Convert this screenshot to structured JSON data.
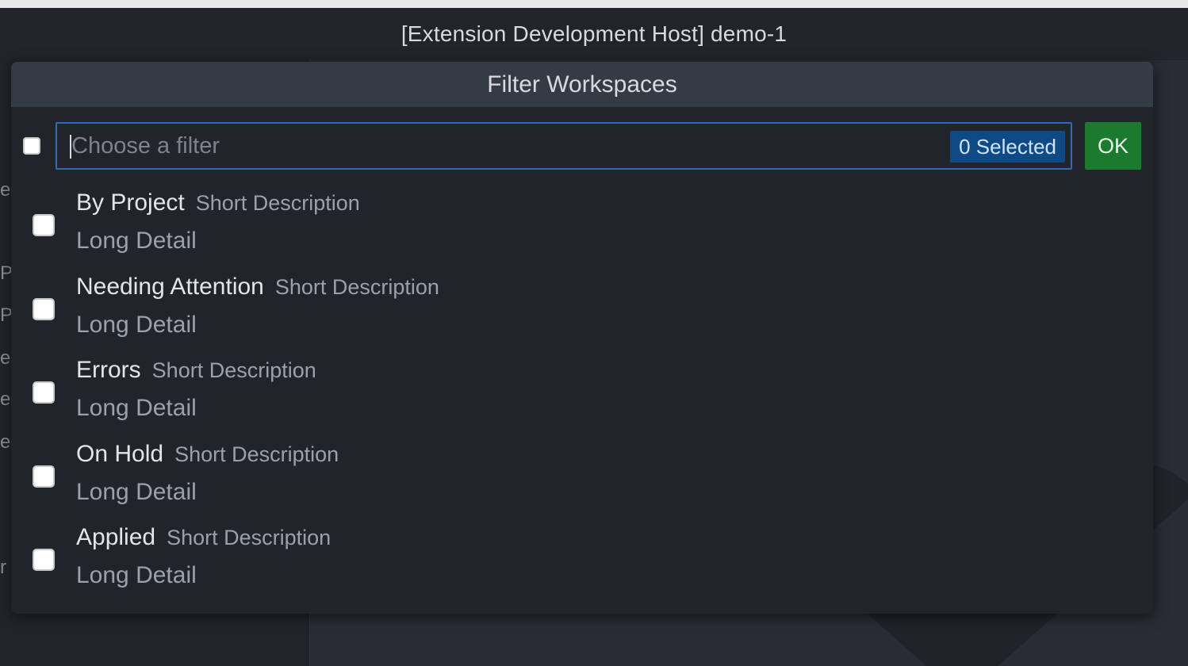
{
  "window": {
    "title": "[Extension Development Host] demo-1"
  },
  "quickpick": {
    "title": "Filter Workspaces",
    "filter_placeholder": "Choose a filter",
    "filter_value": "",
    "selected_count_label": "0 Selected",
    "ok_label": "OK",
    "items": [
      {
        "label": "By Project",
        "description": "Short Description",
        "detail": "Long Detail",
        "checked": false
      },
      {
        "label": "Needing Attention",
        "description": "Short Description",
        "detail": "Long Detail",
        "checked": false
      },
      {
        "label": "Errors",
        "description": "Short Description",
        "detail": "Long Detail",
        "checked": false
      },
      {
        "label": "On Hold",
        "description": "Short Description",
        "detail": "Long Detail",
        "checked": false
      },
      {
        "label": "Applied",
        "description": "Short Description",
        "detail": "Long Detail",
        "checked": false
      }
    ]
  },
  "colors": {
    "accent_focus_border": "#2f6cb8",
    "badge_background": "#0f4a85",
    "ok_button_background": "#1c7a2f",
    "panel_background": "#21252b",
    "header_background": "#353b45"
  }
}
